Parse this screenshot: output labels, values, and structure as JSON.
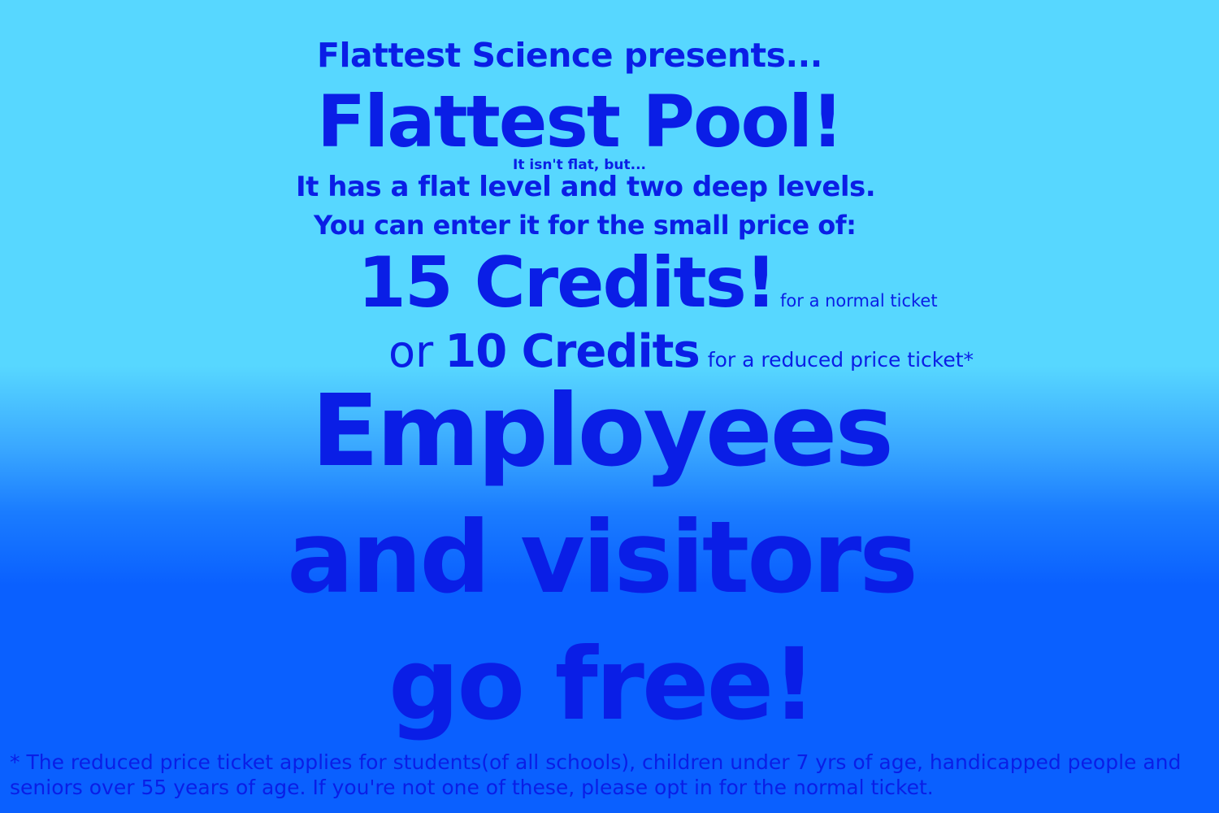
{
  "poster": {
    "presenter": "Flattest Science presents...",
    "title": "Flattest Pool!",
    "note": "It isn't flat, but...",
    "description_line1": "It has a flat level and two deep levels.",
    "description_line2": "You can enter it for the small price of:",
    "normal_price": "15 Credits!",
    "normal_price_label": "for a normal ticket",
    "or_text": "or",
    "reduced_price": "10 Credits",
    "reduced_price_label": "for a reduced price ticket*",
    "free_text": "Employees and visitors go free!",
    "footnote": "* The reduced price ticket applies for students(of all schools), children under 7 yrs of age, handicapped people and seniors over 55 years of age. If you're not one of these, please opt in for the normal ticket."
  },
  "colors": {
    "text": "#0a1ee6",
    "background_top": "#57d7ff",
    "background_bottom": "#0a60ff"
  }
}
